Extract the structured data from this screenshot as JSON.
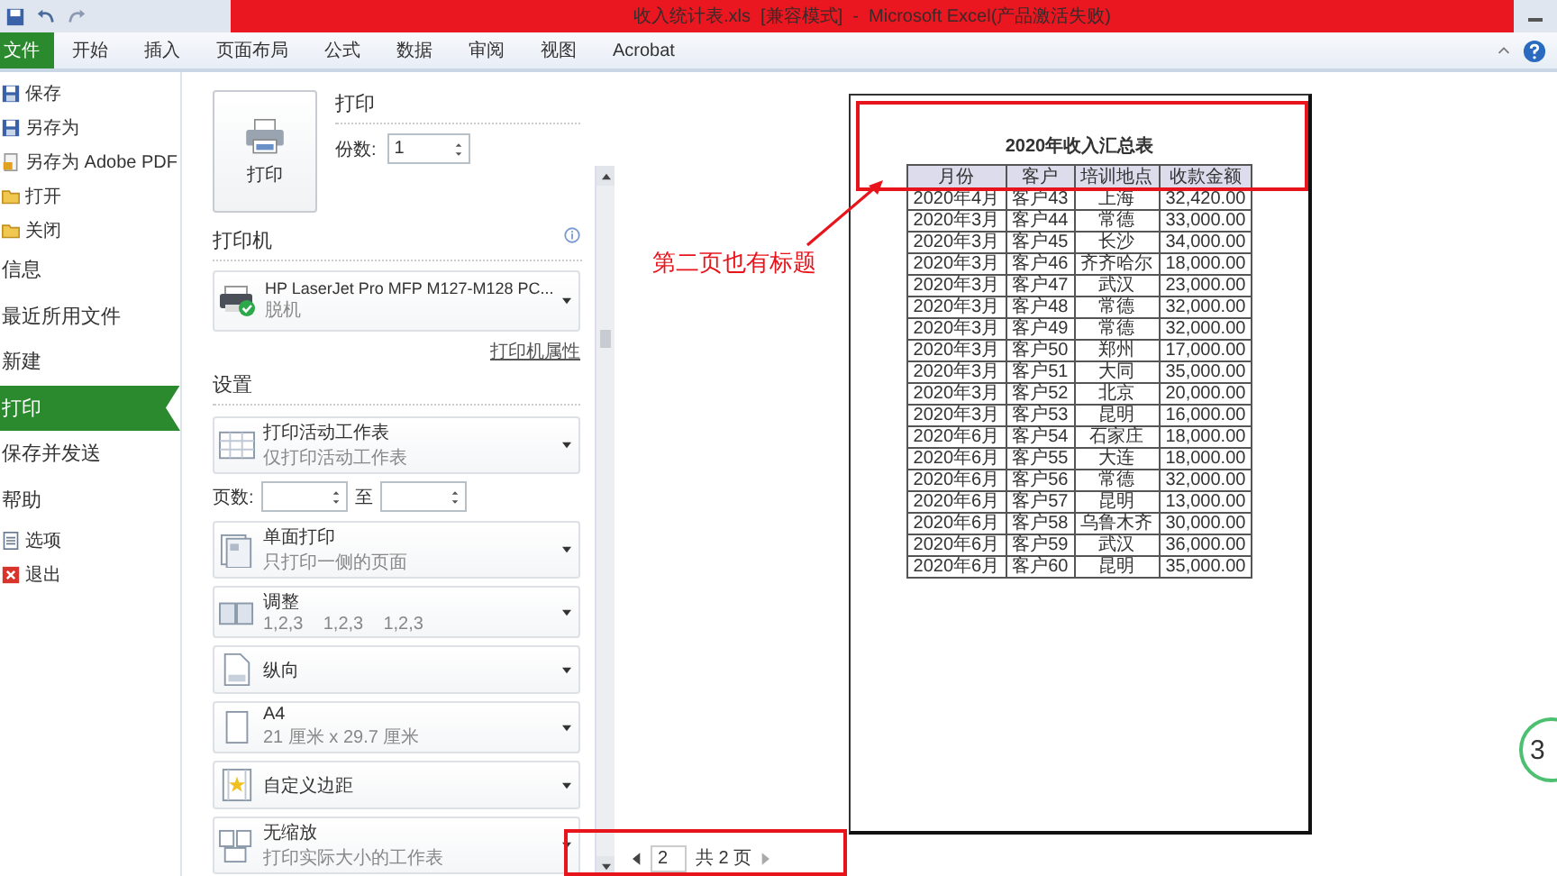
{
  "window": {
    "title": "收入统计表.xls  [兼容模式]  -  Microsoft Excel(产品激活失败)"
  },
  "ribbon_tabs": [
    {
      "label": "文件",
      "selected": true
    },
    {
      "label": "开始",
      "selected": false
    },
    {
      "label": "插入",
      "selected": false
    },
    {
      "label": "页面布局",
      "selected": false
    },
    {
      "label": "公式",
      "selected": false
    },
    {
      "label": "数据",
      "selected": false
    },
    {
      "label": "审阅",
      "selected": false
    },
    {
      "label": "视图",
      "selected": false
    },
    {
      "label": "Acrobat",
      "selected": false
    }
  ],
  "backstage_menu": [
    {
      "label": "保存",
      "kind": "command",
      "selected": false
    },
    {
      "label": "另存为",
      "kind": "command",
      "selected": false
    },
    {
      "label": "另存为 Adobe PDF",
      "kind": "command",
      "selected": false
    },
    {
      "label": "打开",
      "kind": "command",
      "selected": false
    },
    {
      "label": "关闭",
      "kind": "command",
      "selected": false
    },
    {
      "label": "信息",
      "kind": "section",
      "selected": false
    },
    {
      "label": "最近所用文件",
      "kind": "section",
      "selected": false
    },
    {
      "label": "新建",
      "kind": "section",
      "selected": false
    },
    {
      "label": "打印",
      "kind": "section",
      "selected": true
    },
    {
      "label": "保存并发送",
      "kind": "section",
      "selected": false
    },
    {
      "label": "帮助",
      "kind": "section",
      "selected": false
    },
    {
      "label": "选项",
      "kind": "command",
      "selected": false
    },
    {
      "label": "退出",
      "kind": "command",
      "selected": false
    }
  ],
  "print": {
    "heading": "打印",
    "button_label": "打印",
    "copies_label": "份数:",
    "copies": "1"
  },
  "printer": {
    "heading": "打印机",
    "name": "HP LaserJet Pro MFP M127-M128 PC...",
    "status": "脱机",
    "properties_link": "打印机属性"
  },
  "settings": {
    "heading": "设置",
    "pages_label": "页数:",
    "to_label": "至",
    "options": [
      {
        "title": "打印活动工作表",
        "subtitle": "仅打印活动工作表"
      },
      {
        "title": "单面打印",
        "subtitle": "只打印一侧的页面"
      },
      {
        "title": "调整",
        "subtitle": "1,2,3    1,2,3    1,2,3"
      },
      {
        "title": "纵向"
      },
      {
        "title": "A4",
        "subtitle": "21 厘米 x 29.7 厘米"
      },
      {
        "title": "自定义边距"
      },
      {
        "title": "无缩放",
        "subtitle": "打印实际大小的工作表"
      }
    ]
  },
  "preview": {
    "sheet_title": "2020年收入汇总表",
    "columns": [
      "月份",
      "客户",
      "培训地点",
      "收款金额"
    ],
    "rows": [
      [
        "2020年4月",
        "客户43",
        "上海",
        "32,420.00"
      ],
      [
        "2020年3月",
        "客户44",
        "常德",
        "33,000.00"
      ],
      [
        "2020年3月",
        "客户45",
        "长沙",
        "34,000.00"
      ],
      [
        "2020年3月",
        "客户46",
        "齐齐哈尔",
        "18,000.00"
      ],
      [
        "2020年3月",
        "客户47",
        "武汉",
        "23,000.00"
      ],
      [
        "2020年3月",
        "客户48",
        "常德",
        "32,000.00"
      ],
      [
        "2020年3月",
        "客户49",
        "常德",
        "32,000.00"
      ],
      [
        "2020年3月",
        "客户50",
        "郑州",
        "17,000.00"
      ],
      [
        "2020年3月",
        "客户51",
        "大同",
        "35,000.00"
      ],
      [
        "2020年3月",
        "客户52",
        "北京",
        "20,000.00"
      ],
      [
        "2020年3月",
        "客户53",
        "昆明",
        "16,000.00"
      ],
      [
        "2020年6月",
        "客户54",
        "石家庄",
        "18,000.00"
      ],
      [
        "2020年6月",
        "客户55",
        "大连",
        "18,000.00"
      ],
      [
        "2020年6月",
        "客户56",
        "常德",
        "32,000.00"
      ],
      [
        "2020年6月",
        "客户57",
        "昆明",
        "13,000.00"
      ],
      [
        "2020年6月",
        "客户58",
        "乌鲁木齐",
        "30,000.00"
      ],
      [
        "2020年6月",
        "客户59",
        "武汉",
        "36,000.00"
      ],
      [
        "2020年6月",
        "客户60",
        "昆明",
        "35,000.00"
      ]
    ]
  },
  "pager": {
    "current": "2",
    "total": "共 2 页"
  },
  "annotation": {
    "callout": "第二页也有标题"
  },
  "badge": {
    "text": "3"
  }
}
